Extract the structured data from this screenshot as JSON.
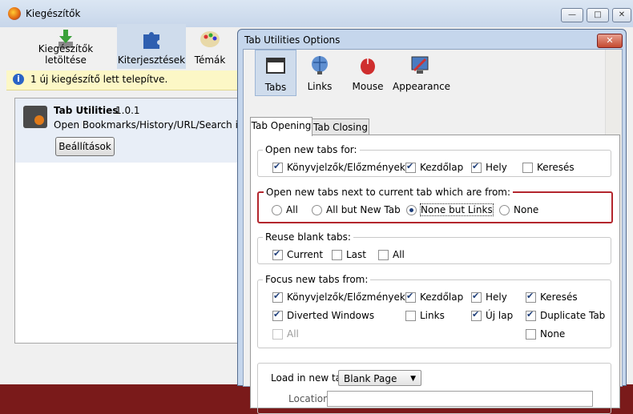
{
  "bg_window": {
    "title": "Kiegészítők",
    "controls": {
      "minimize": "—",
      "maximize": "□",
      "close": "✕"
    },
    "toolbar": [
      {
        "label": "Kiegészítők letöltése"
      },
      {
        "label": "Kiterjesztések"
      },
      {
        "label": "Témák"
      }
    ],
    "notice": "1 új kiegészítő lett telepítve.",
    "extension": {
      "name": "Tab Utilities",
      "version": "1.0.1",
      "description": "Open Bookmarks/History/URL/Search in ne",
      "settings_button": "Beállítások"
    }
  },
  "dialog": {
    "title": "Tab Utilities Options",
    "close": "✕",
    "panes": [
      {
        "label": "Tabs"
      },
      {
        "label": "Links"
      },
      {
        "label": "Mouse"
      },
      {
        "label": "Appearance"
      }
    ],
    "tabs": [
      {
        "label": "Tab Opening"
      },
      {
        "label": "Tab Closing"
      }
    ],
    "open_for": {
      "title": "Open new tabs for:",
      "items": [
        {
          "label": "Könyvjelzők/Előzmények",
          "checked": true
        },
        {
          "label": "Kezdőlap",
          "checked": true
        },
        {
          "label": "Hely",
          "checked": true
        },
        {
          "label": "Keresés",
          "checked": false
        }
      ]
    },
    "next_to": {
      "title": "Open new tabs next to current tab which are from:",
      "options": [
        {
          "label": "All",
          "selected": false
        },
        {
          "label": "All but New Tab",
          "selected": false
        },
        {
          "label": "None but Links",
          "selected": true
        },
        {
          "label": "None",
          "selected": false
        }
      ]
    },
    "reuse": {
      "title": "Reuse blank tabs:",
      "items": [
        {
          "label": "Current",
          "checked": true
        },
        {
          "label": "Last",
          "checked": false
        },
        {
          "label": "All",
          "checked": false
        }
      ]
    },
    "focus": {
      "title": "Focus new tabs from:",
      "items": [
        {
          "label": "Könyvjelzők/Előzmények",
          "checked": true
        },
        {
          "label": "Kezdőlap",
          "checked": true
        },
        {
          "label": "Hely",
          "checked": true
        },
        {
          "label": "Keresés",
          "checked": true
        },
        {
          "label": "Diverted Windows",
          "checked": true
        },
        {
          "label": "Links",
          "checked": false
        },
        {
          "label": "Új lap",
          "checked": true
        },
        {
          "label": "Duplicate Tab",
          "checked": true
        },
        {
          "label": "All",
          "checked": false,
          "disabled": true
        },
        {
          "label": "None",
          "checked": false
        }
      ]
    },
    "load": {
      "label": "Load in new tab:",
      "value": "Blank Page",
      "location_label": "Location:",
      "location_value": ""
    }
  }
}
